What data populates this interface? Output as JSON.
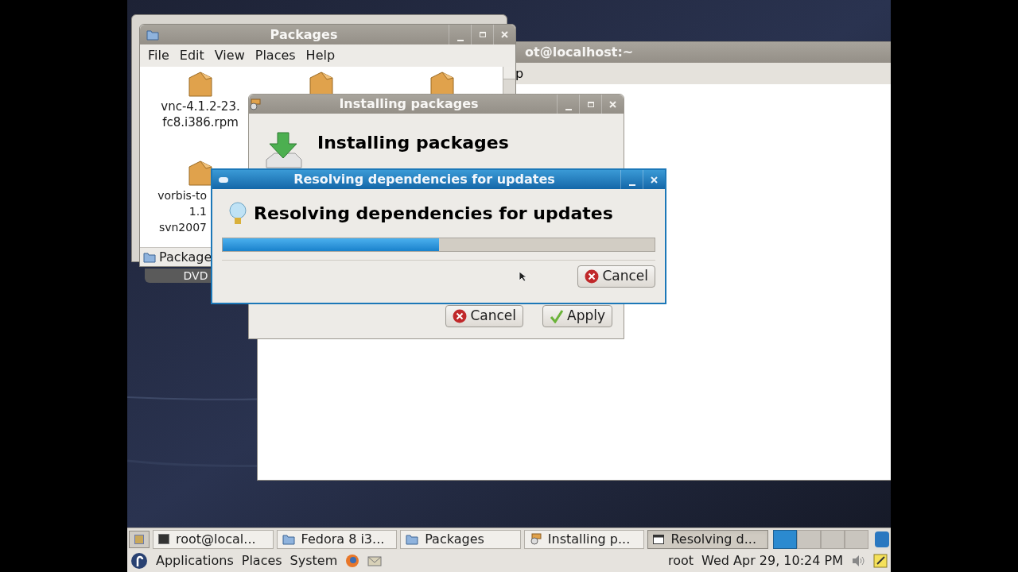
{
  "desktop_label": {
    "text": "DVD"
  },
  "terminal": {
    "title": "ot@localhost:~",
    "menu_fragment": "p"
  },
  "packages_window": {
    "title": "Packages",
    "menu": [
      "File",
      "Edit",
      "View",
      "Places",
      "Help"
    ],
    "files": [
      {
        "kind": "whole",
        "lines": [
          "vnc-4.1.2-23.",
          "fc8.i386.rpm"
        ]
      },
      {
        "kind": "icon_only"
      },
      {
        "kind": "icon_only"
      },
      {
        "kind": "cut_off",
        "lines": [
          "vorbis-to",
          "1.1",
          "svn2007"
        ]
      }
    ],
    "status": "Package"
  },
  "installing_window": {
    "title": "Installing packages",
    "heading": "Installing packages",
    "buttons": [
      {
        "kind": "cancel",
        "label": "Cancel"
      },
      {
        "kind": "apply",
        "label": "Apply"
      }
    ]
  },
  "resolving_window": {
    "title": "Resolving dependencies for updates",
    "heading": "Resolving dependencies for updates",
    "progress": {
      "level": 0.5
    },
    "button": {
      "kind": "cancel",
      "label": "Cancel"
    }
  },
  "taskbar": [
    {
      "kind": "terminal",
      "label": "root@local...",
      "selected": false
    },
    {
      "kind": "folder",
      "label": "Fedora 8 i3...",
      "selected": false
    },
    {
      "kind": "folder",
      "label": "Packages",
      "selected": false
    },
    {
      "kind": "installer",
      "label": "Installing p...",
      "selected": false
    },
    {
      "kind": "window",
      "label": "Resolving d...",
      "selected": true
    }
  ],
  "panel": {
    "menus": [
      "Applications",
      "Places",
      "System"
    ],
    "user": "root",
    "clock": "Wed Apr 29, 10:24 PM"
  }
}
